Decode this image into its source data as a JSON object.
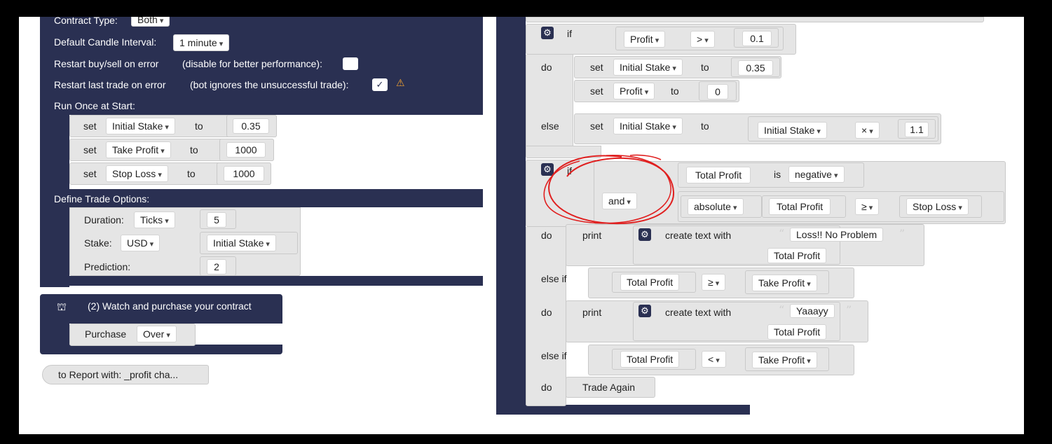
{
  "left_panel": {
    "contract_type_label": "Contract Type:",
    "contract_type_value": "Both",
    "candle_interval_label": "Default Candle Interval:",
    "candle_interval_value": "1 minute",
    "restart_buysell_label": "Restart buy/sell on error",
    "restart_buysell_hint": "(disable for better performance):",
    "restart_last_label": "Restart last trade on error",
    "restart_last_hint": "(bot ignores the unsuccessful trade):",
    "restart_last_check": "✓",
    "run_once_label": "Run Once at Start:",
    "run_once_rows": [
      {
        "set": "set",
        "var": "Initial Stake",
        "to": "to",
        "value": "0.35"
      },
      {
        "set": "set",
        "var": "Take Profit",
        "to": "to",
        "value": "1000"
      },
      {
        "set": "set",
        "var": "Stop Loss",
        "to": "to",
        "value": "1000"
      }
    ],
    "define_trade_label": "Define Trade Options:",
    "duration_label": "Duration:",
    "duration_unit": "Ticks",
    "duration_value": "5",
    "stake_label": "Stake:",
    "stake_currency": "USD",
    "stake_var": "Initial Stake",
    "prediction_label": "Prediction:",
    "prediction_value": "2",
    "watch_title": "(2) Watch and purchase your contract",
    "purchase_label": "Purchase",
    "purchase_value": "Over",
    "report_label": "to Report with: _profit cha..."
  },
  "right_panel": {
    "if1": {
      "if": "if",
      "var": "Profit",
      "op": ">",
      "value": "0.1",
      "do": "do",
      "do_rows": [
        {
          "set": "set",
          "var": "Initial Stake",
          "to": "to",
          "value": "0.35"
        },
        {
          "set": "set",
          "var": "Profit",
          "to": "to",
          "value": "0"
        }
      ],
      "else": "else",
      "else_set": "set",
      "else_var": "Initial Stake",
      "else_to": "to",
      "else_expr_var": "Initial Stake",
      "else_expr_op": "×",
      "else_expr_value": "1.1"
    },
    "if2": {
      "if": "if",
      "logic_op": "and",
      "cond1_var": "Total Profit",
      "cond1_is": "is",
      "cond1_value": "negative",
      "cond2_fn": "absolute",
      "cond2_var": "Total Profit",
      "cond2_op": "≥",
      "cond2_rhs": "Stop Loss",
      "do": "do",
      "print1": "print",
      "create_text1": "create text with",
      "text1": "Loss!! No Problem",
      "text1_var": "Total Profit",
      "elseif1": "else if",
      "elseif1_var": "Total Profit",
      "elseif1_op": "≥",
      "elseif1_rhs": "Take Profit",
      "do2": "do",
      "print2": "print",
      "create_text2": "create text with",
      "text2": "Yaaayy",
      "text2_var": "Total Profit",
      "elseif2": "else if",
      "elseif2_var": "Total Profit",
      "elseif2_op": "<",
      "elseif2_rhs": "Take Profit",
      "do3": "do",
      "trade_again": "Trade Again"
    }
  },
  "icons": {
    "gear": "⚙",
    "basket": "⛫",
    "warning": "⚠"
  },
  "colors": {
    "block_navy": "#2a3052",
    "block_grey": "#e5e5e5",
    "annotation_red": "#e02020"
  }
}
